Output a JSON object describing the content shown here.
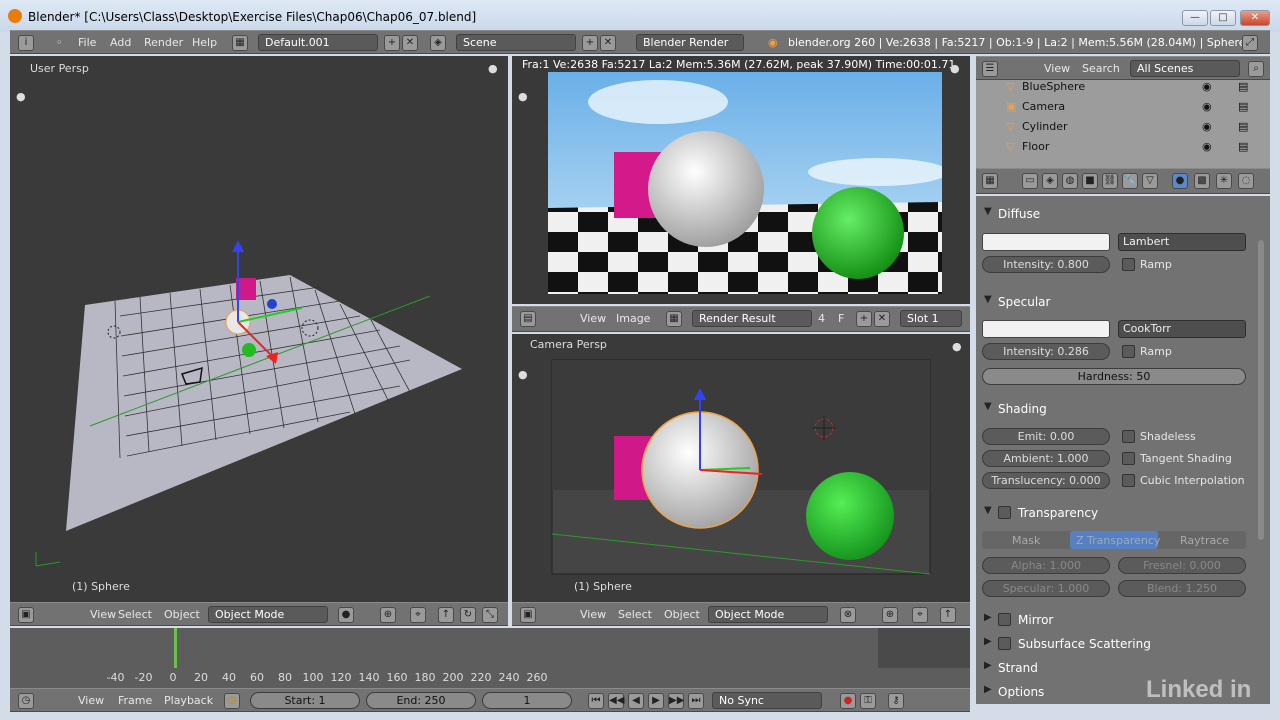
{
  "window": {
    "title": "Blender* [C:\\Users\\Class\\Desktop\\Exercise Files\\Chap06\\Chap06_07.blend]",
    "min": "—",
    "max": "□",
    "close": "✕"
  },
  "infobar": {
    "menus": [
      "File",
      "Add",
      "Render",
      "Help"
    ],
    "screen": "Default.001",
    "scene": "Scene",
    "engine": "Blender Render",
    "stats": "blender.org 260 | Ve:2638 | Fa:5217 | Ob:1-9 | La:2 | Mem:5.56M (28.04M) | Sphere"
  },
  "viewport_left": {
    "title": "User Persp",
    "object": "(1) Sphere",
    "menus": [
      "View",
      "Select",
      "Object"
    ],
    "mode": "Object Mode"
  },
  "render_view": {
    "stats": "Fra:1  Ve:2638 Fa:5217 La:2 Mem:5.36M (27.62M, peak 37.90M) Time:00:01.71",
    "menus": [
      "View",
      "Image"
    ],
    "result": "Render Result",
    "num": "4",
    "f": "F",
    "slot": "Slot 1"
  },
  "viewport_camera": {
    "title": "Camera Persp",
    "object": "(1) Sphere",
    "menus": [
      "View",
      "Select",
      "Object"
    ],
    "mode": "Object Mode"
  },
  "outliner": {
    "menus": [
      "View",
      "Search"
    ],
    "filter": "All Scenes",
    "items": [
      "BlueSphere",
      "Camera",
      "Cylinder",
      "Floor"
    ]
  },
  "material": {
    "diffuse": {
      "title": "Diffuse",
      "shader": "Lambert",
      "intensity": "Intensity: 0.800",
      "ramp": "Ramp"
    },
    "specular": {
      "title": "Specular",
      "shader": "CookTorr",
      "intensity": "Intensity: 0.286",
      "ramp": "Ramp",
      "hardness": "Hardness: 50"
    },
    "shading": {
      "title": "Shading",
      "emit": "Emit: 0.00",
      "ambient": "Ambient: 1.000",
      "translucency": "Translucency: 0.000",
      "shadeless": "Shadeless",
      "tangent": "Tangent Shading",
      "cubic": "Cubic Interpolation"
    },
    "transparency": {
      "title": "Transparency",
      "tabs": [
        "Mask",
        "Z Transparency",
        "Raytrace"
      ],
      "alpha": "Alpha: 1.000",
      "fresnel": "Fresnel: 0.000",
      "specular": "Specular: 1.000",
      "blend": "Blend: 1.250"
    },
    "collapsed": [
      "Mirror",
      "Subsurface Scattering",
      "Strand",
      "Options"
    ]
  },
  "timeline": {
    "ticks": [
      "-40",
      "-20",
      "0",
      "20",
      "40",
      "60",
      "80",
      "100",
      "120",
      "140",
      "160",
      "180",
      "200",
      "220",
      "240",
      "260"
    ],
    "menus": [
      "View",
      "Frame",
      "Playback"
    ],
    "start": "Start: 1",
    "end": "End: 250",
    "current": "1",
    "sync": "No Sync"
  },
  "watermark": "Linked in"
}
